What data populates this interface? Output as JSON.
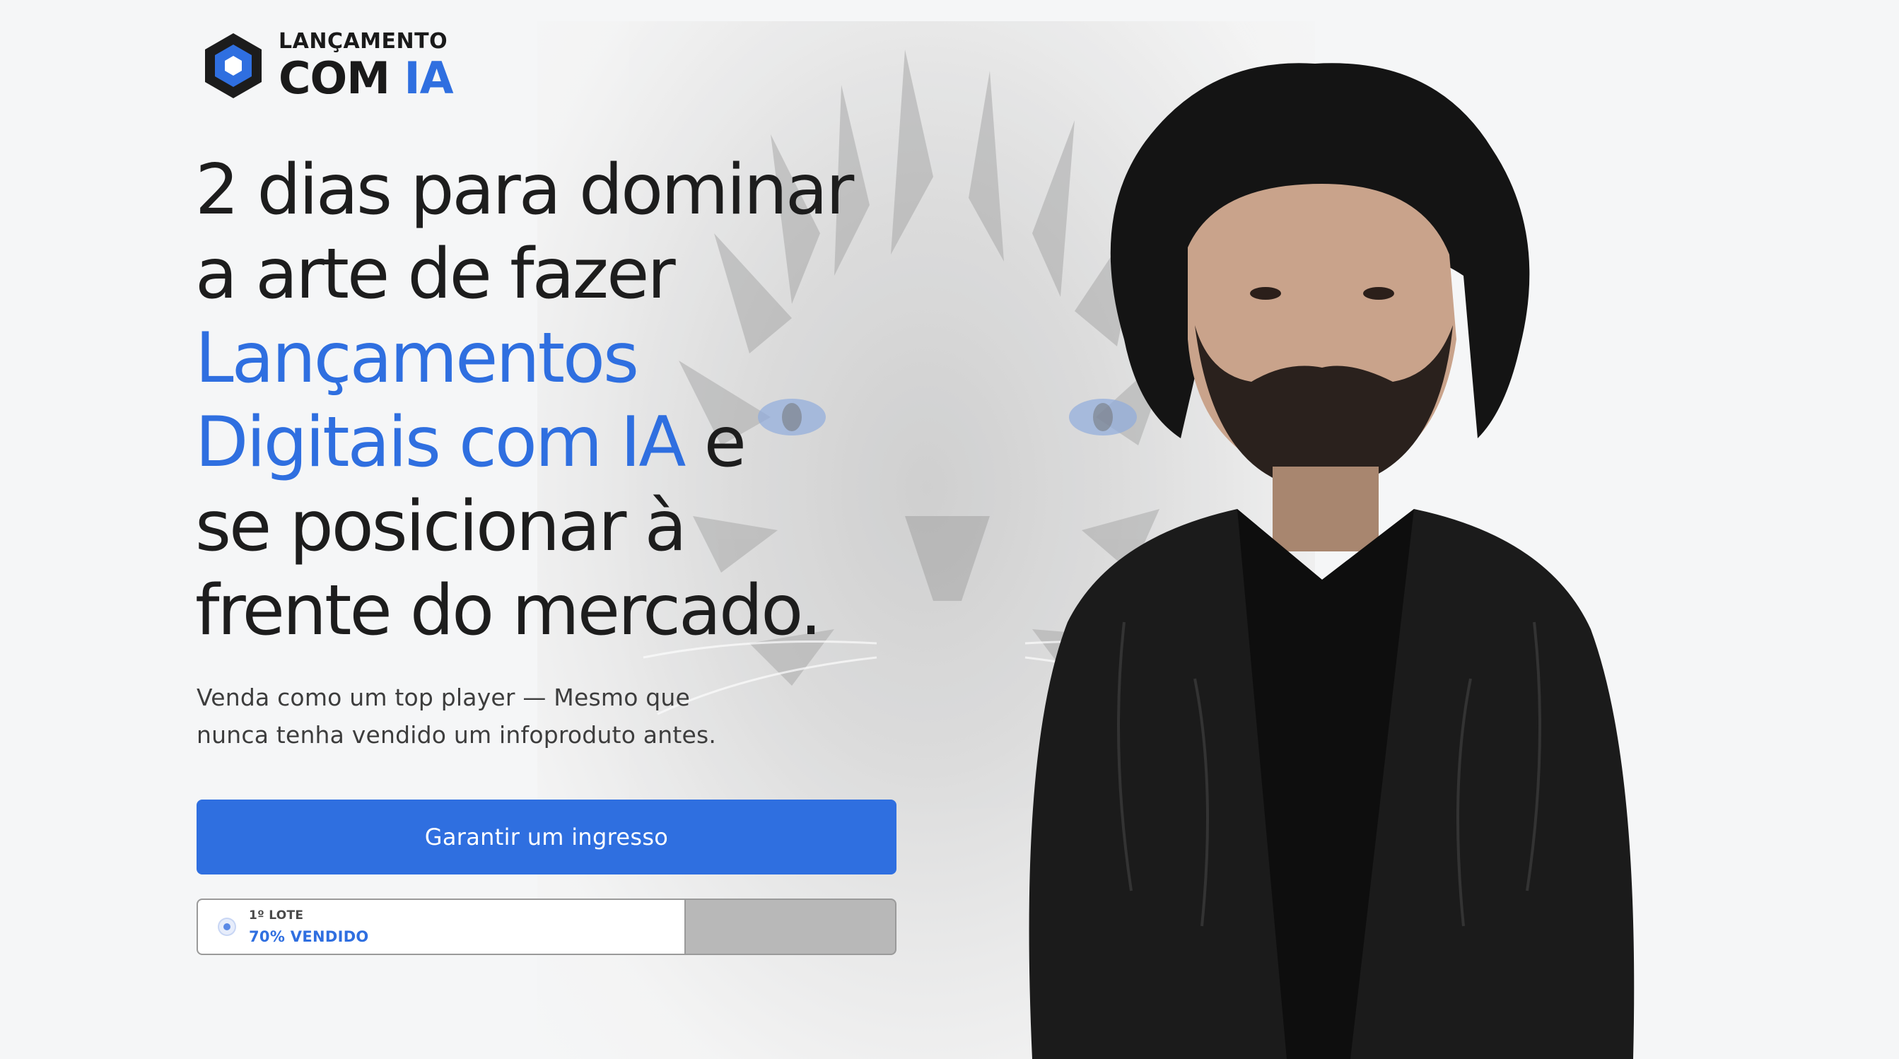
{
  "brand": {
    "logo_top": "LANÇAMENTO",
    "logo_bottom_main": "COM",
    "logo_bottom_accent": "IA",
    "accent_color": "#2f6fe0"
  },
  "hero": {
    "headline": {
      "line1": "2 dias para dominar",
      "line2": "a arte de fazer",
      "line3_accent": "Lançamentos",
      "line4_accent": "Digitais com IA",
      "line4_rest": " e",
      "line5": "se posicionar à",
      "line6": "frente do mercado."
    },
    "subtitle": {
      "line1": "Venda como um top player — Mesmo que",
      "line2": "nunca tenha vendido um infoproduto antes."
    },
    "cta_label": "Garantir um ingresso",
    "ticket": {
      "lot_label": "1º LOTE",
      "sold_label": "70% VENDIDO",
      "sold_fraction": 0.7
    }
  },
  "images": {
    "background": "tiger-face",
    "person": "presenter-portrait"
  }
}
